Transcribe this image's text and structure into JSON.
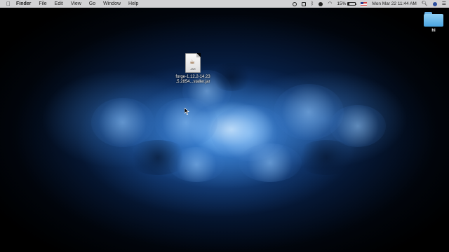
{
  "menubar": {
    "apple_icon": "apple-logo-icon",
    "app_name": "Finder",
    "menus": [
      "File",
      "Edit",
      "View",
      "Go",
      "Window",
      "Help"
    ]
  },
  "status": {
    "battery_percent_label": "15%",
    "battery_level": 0.15,
    "datetime": "Mon Mar 22  11:44 AM",
    "icons": [
      "record-icon",
      "screen-icon",
      "bluetooth-icon",
      "alert-icon",
      "wifi-icon",
      "battery-icon",
      "flag-icon",
      "search-icon",
      "siri-icon",
      "menu-list-icon"
    ]
  },
  "desktop": {
    "jar_file": {
      "name_line1": "forge-1.12.2-14.23",
      "name_line2": ".5.2854...staller.jar",
      "badge": "JAR"
    },
    "folder": {
      "name": "hi"
    }
  },
  "colors": {
    "menubar_bg": "#e4e4e6",
    "folder_blue": "#4aa4e0",
    "wallpaper_accent": "#3a8ee0"
  }
}
